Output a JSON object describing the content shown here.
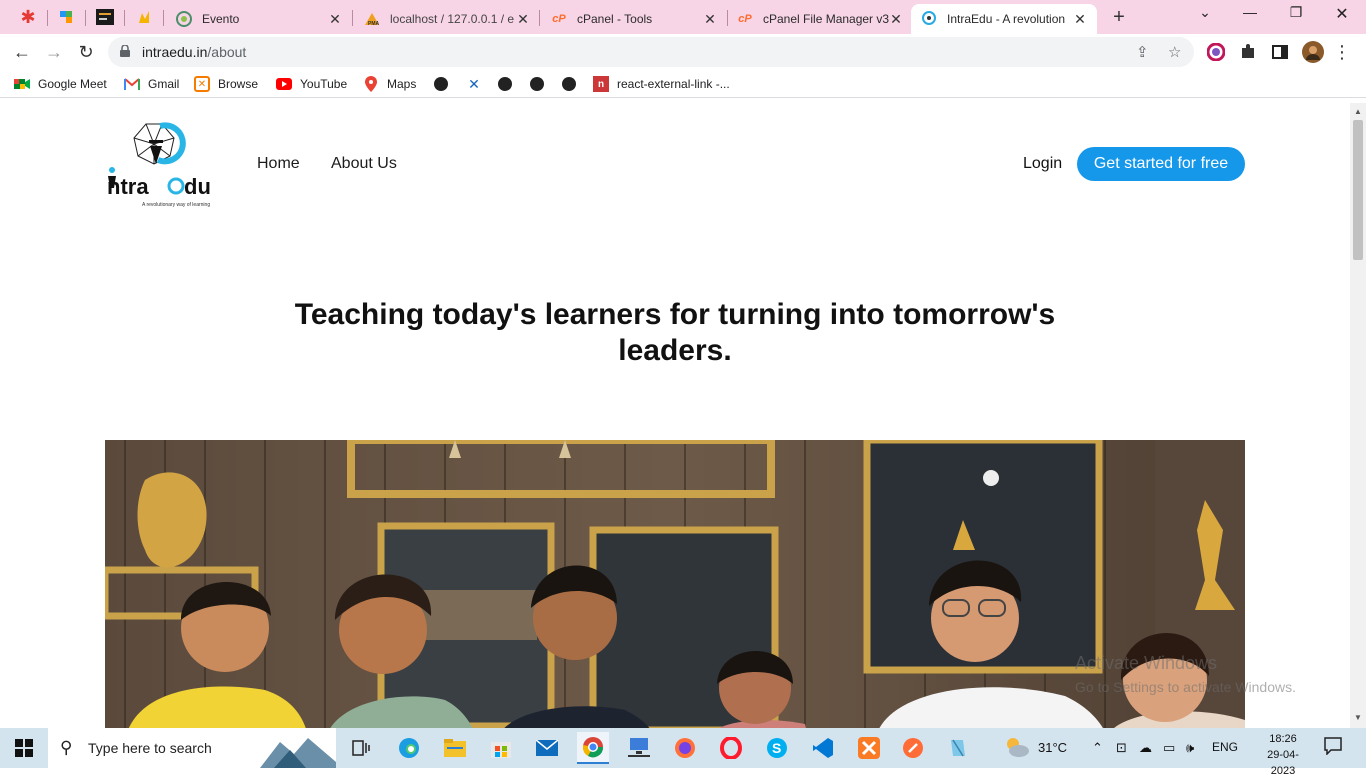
{
  "browser": {
    "tabs": [
      {
        "title": "Evento"
      },
      {
        "title": "localhost / 127.0.0.1 / e"
      },
      {
        "title": "cPanel - Tools"
      },
      {
        "title": "cPanel File Manager v3"
      },
      {
        "title": "IntraEdu - A revolution"
      }
    ],
    "address": {
      "domain": "intraedu.in",
      "path": "/about"
    },
    "bookmarks": [
      "Google Meet",
      "Gmail",
      "Browse",
      "YouTube",
      "Maps",
      "react-external-link -..."
    ]
  },
  "site": {
    "logo_text": "Intra Edu",
    "logo_tagline": "A revolutionary way of learning",
    "nav": {
      "home": "Home",
      "about": "About Us"
    },
    "login": "Login",
    "cta": "Get started for free",
    "hero_heading": "Teaching today's learners for turning into tomorrow's leaders."
  },
  "windows_watermark": {
    "line1": "Activate Windows",
    "line2": "Go to Settings to activate Windows."
  },
  "taskbar": {
    "search_placeholder": "Type here to search",
    "weather": "31°C",
    "language": "ENG",
    "time": "18:26",
    "date": "29-04-2023"
  },
  "colors": {
    "accent": "#1597ea",
    "tab_strip": "#f7d5e6",
    "taskbar": "#d4e4ef"
  }
}
